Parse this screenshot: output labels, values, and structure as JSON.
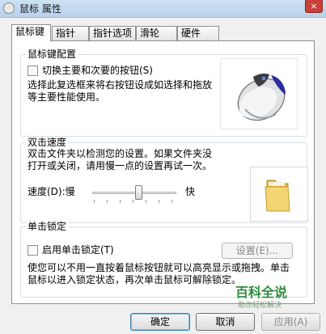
{
  "window": {
    "title": "鼠标 属性",
    "close_glyph": "×"
  },
  "tabs": [
    "鼠标键",
    "指针",
    "指针选项",
    "滑轮",
    "硬件"
  ],
  "button_config": {
    "legend": "鼠标键配置",
    "swap_label": "切换主要和次要的按钮(S)",
    "description_line1": "选择此复选框来将右按钮设成如选择和拖放",
    "description_line2": "等主要性能使用。"
  },
  "double_click": {
    "legend": "双击速度",
    "description_line1": "双击文件夹以检测您的设置。如果文件夹没",
    "description_line2": "打开或关闭，请用慢一点的设置再试一次。",
    "speed_label": "速度(D):慢",
    "fast_label": "快",
    "speed_value": 0.55
  },
  "click_lock": {
    "legend": "单击锁定",
    "enable_label": "启用单击锁定(T)",
    "settings_button": "设置(E)...",
    "description_line1": "使您可以不用一直按着鼠标按钮就可以高亮显示或拖拽。单击",
    "description_line2": "鼠标以进入锁定状态，再次单击鼠标可解除锁定。"
  },
  "footer": {
    "ok": "确定",
    "cancel": "取消",
    "apply": "应用(A)"
  },
  "watermark": {
    "title": "百科全说",
    "subtitle": "助你轻松解决"
  },
  "colors": {
    "title_bar": "#bcd4ee",
    "close_button": "#c9403a",
    "watermark": "#2a8c3a"
  },
  "icons": [
    "mouse-icon",
    "folder-icon",
    "close-icon"
  ]
}
